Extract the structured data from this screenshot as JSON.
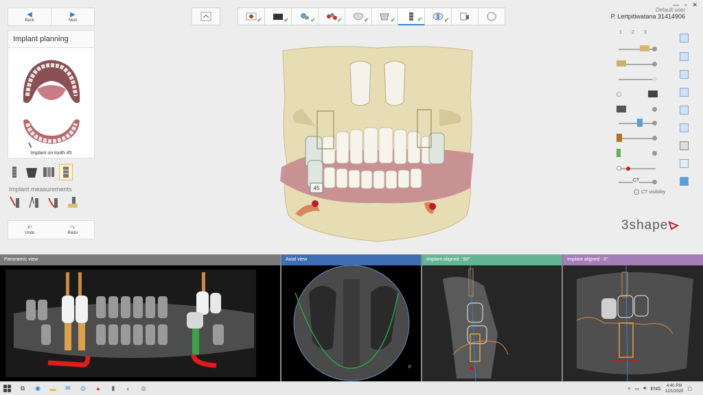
{
  "window": {
    "user_label": "Default user",
    "patient": "P. Lertpitiwatana 31414906",
    "controls": [
      "—",
      "▫",
      "✕"
    ]
  },
  "nav": {
    "back_label": "Back",
    "next_label": "Next"
  },
  "left_panel": {
    "title": "Implant planning",
    "caption": "Implant on tooth 45",
    "tools": [
      "implant-icon",
      "abutment-icon",
      "implant-group-icon",
      "implant-selected-icon"
    ],
    "measurements_title": "Implant measurements",
    "measure_tools": [
      "distance-icon",
      "angle-icon",
      "nerve-distance-icon",
      "bone-density-icon"
    ],
    "undo_label": "Undo",
    "redo_label": "Redo"
  },
  "workflow": {
    "steps": [
      "scan-icon",
      "crown-icon",
      "bite-icon",
      "teeth-icon",
      "tooth-icon",
      "model-icon",
      "implant-icon",
      "ct-icon",
      "guide-icon",
      "finish-icon"
    ],
    "completed": [
      true,
      true,
      true,
      true,
      true,
      true,
      true,
      true,
      false,
      false
    ]
  },
  "view3d": {
    "tooth_label": "45"
  },
  "right_panel": {
    "tabs": [
      "1",
      "2",
      "3"
    ],
    "ct_visibility_label": "CT visibility",
    "ct_value": "CT"
  },
  "brand": {
    "logo": "3shape"
  },
  "panes": [
    {
      "title": "Panoramic view",
      "header_color": "#7a7a7a"
    },
    {
      "title": "Axial view",
      "header_color": "#3f6fb3"
    },
    {
      "title": "Implant aligned : 90°",
      "header_color": "#63b595"
    },
    {
      "title": "Implant aligned : 0°",
      "header_color": "#a57db8"
    }
  ],
  "taskbar": {
    "lang": "ENG",
    "time": "4:40 PM",
    "date": "12/1/2020"
  }
}
